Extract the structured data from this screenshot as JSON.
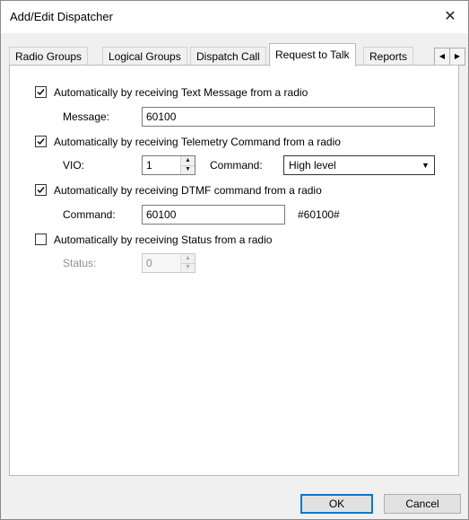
{
  "window": {
    "title": "Add/Edit Dispatcher",
    "close_glyph": "✕"
  },
  "tabs": [
    {
      "label": "Radio Groups",
      "active": false
    },
    {
      "label": "Logical Groups",
      "active": false
    },
    {
      "label": "Dispatch Call",
      "active": false
    },
    {
      "label": "Request to Talk",
      "active": true
    },
    {
      "label": "Reports",
      "active": false
    }
  ],
  "tab_scroll": {
    "left_glyph": "◀",
    "right_glyph": "▶"
  },
  "text_message": {
    "checkbox_label": "Automatically by receiving Text Message from a radio",
    "checked": true,
    "message_label": "Message:",
    "message_value": "60100"
  },
  "telemetry": {
    "checkbox_label": "Automatically by receiving Telemetry Command from a radio",
    "checked": true,
    "vio_label": "VIO:",
    "vio_value": "1",
    "command_label": "Command:",
    "command_value": "High level"
  },
  "dtmf": {
    "checkbox_label": "Automatically by receiving DTMF command from a radio",
    "checked": true,
    "command_label": "Command:",
    "command_value": "60100",
    "preview": "#60100#"
  },
  "status": {
    "checkbox_label": "Automatically by receiving Status from a radio",
    "checked": false,
    "status_label": "Status:",
    "status_value": "0"
  },
  "buttons": {
    "ok_label": "OK",
    "cancel_label": "Cancel"
  }
}
